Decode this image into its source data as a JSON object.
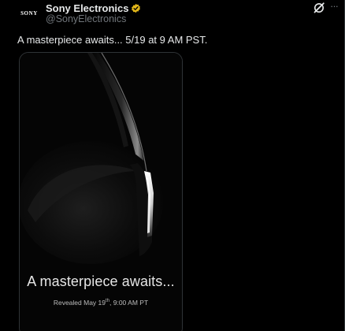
{
  "author": {
    "display_name": "Sony Electronics",
    "handle": "@SonyElectronics",
    "avatar_text": "SONY",
    "verified": true,
    "verified_color": "#e2b719"
  },
  "actions": {
    "grok_icon": "grok-icon",
    "more_label": "···"
  },
  "tweet": {
    "text": "A masterpiece awaits... 5/19 at 9 AM PST."
  },
  "media": {
    "headline": "A masterpiece awaits...",
    "subline_prefix": "Revealed May 19",
    "subline_sup": "th",
    "subline_suffix": ", 9:00 AM PT"
  },
  "colors": {
    "background": "#000000",
    "text_primary": "#e7e9ea",
    "text_secondary": "#71767b",
    "border": "#2f3336"
  }
}
